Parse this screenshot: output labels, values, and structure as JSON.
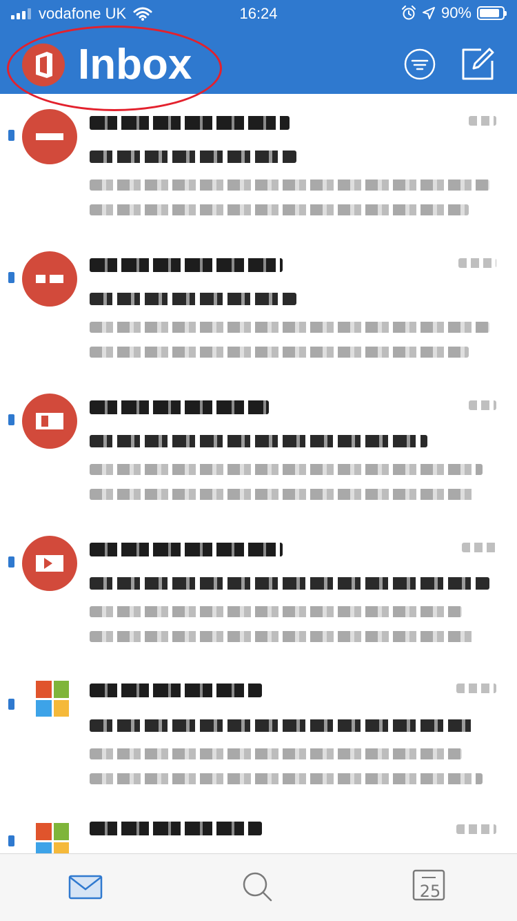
{
  "status_bar": {
    "carrier": "vodafone UK",
    "time": "16:24",
    "battery_percent": "90%",
    "battery_level": 0.9,
    "icons": [
      "signal-icon",
      "wifi-icon",
      "alarm-icon",
      "location-arrow-icon",
      "battery-icon"
    ]
  },
  "header": {
    "title": "Inbox",
    "logo": "office-logo-icon",
    "actions": [
      "filter-icon",
      "compose-icon"
    ]
  },
  "mail_list": {
    "items": [
      {
        "avatar": "red-avatar",
        "unread": true
      },
      {
        "avatar": "red-avatar",
        "unread": true
      },
      {
        "avatar": "red-avatar",
        "unread": true
      },
      {
        "avatar": "red-avatar",
        "unread": true
      },
      {
        "avatar": "microsoft-logo",
        "unread": true
      },
      {
        "avatar": "microsoft-logo",
        "unread": true
      }
    ]
  },
  "tab_bar": {
    "tabs": [
      {
        "name": "mail",
        "icon": "mail-icon",
        "active": true
      },
      {
        "name": "search",
        "icon": "search-icon",
        "active": false
      },
      {
        "name": "calendar",
        "icon": "calendar-icon",
        "label": "25",
        "active": false
      }
    ]
  },
  "colors": {
    "header_blue": "#2f79cf",
    "avatar_red": "#d24a3b",
    "annotation_red": "#e3212d",
    "unread_blue": "#2f79cf"
  }
}
